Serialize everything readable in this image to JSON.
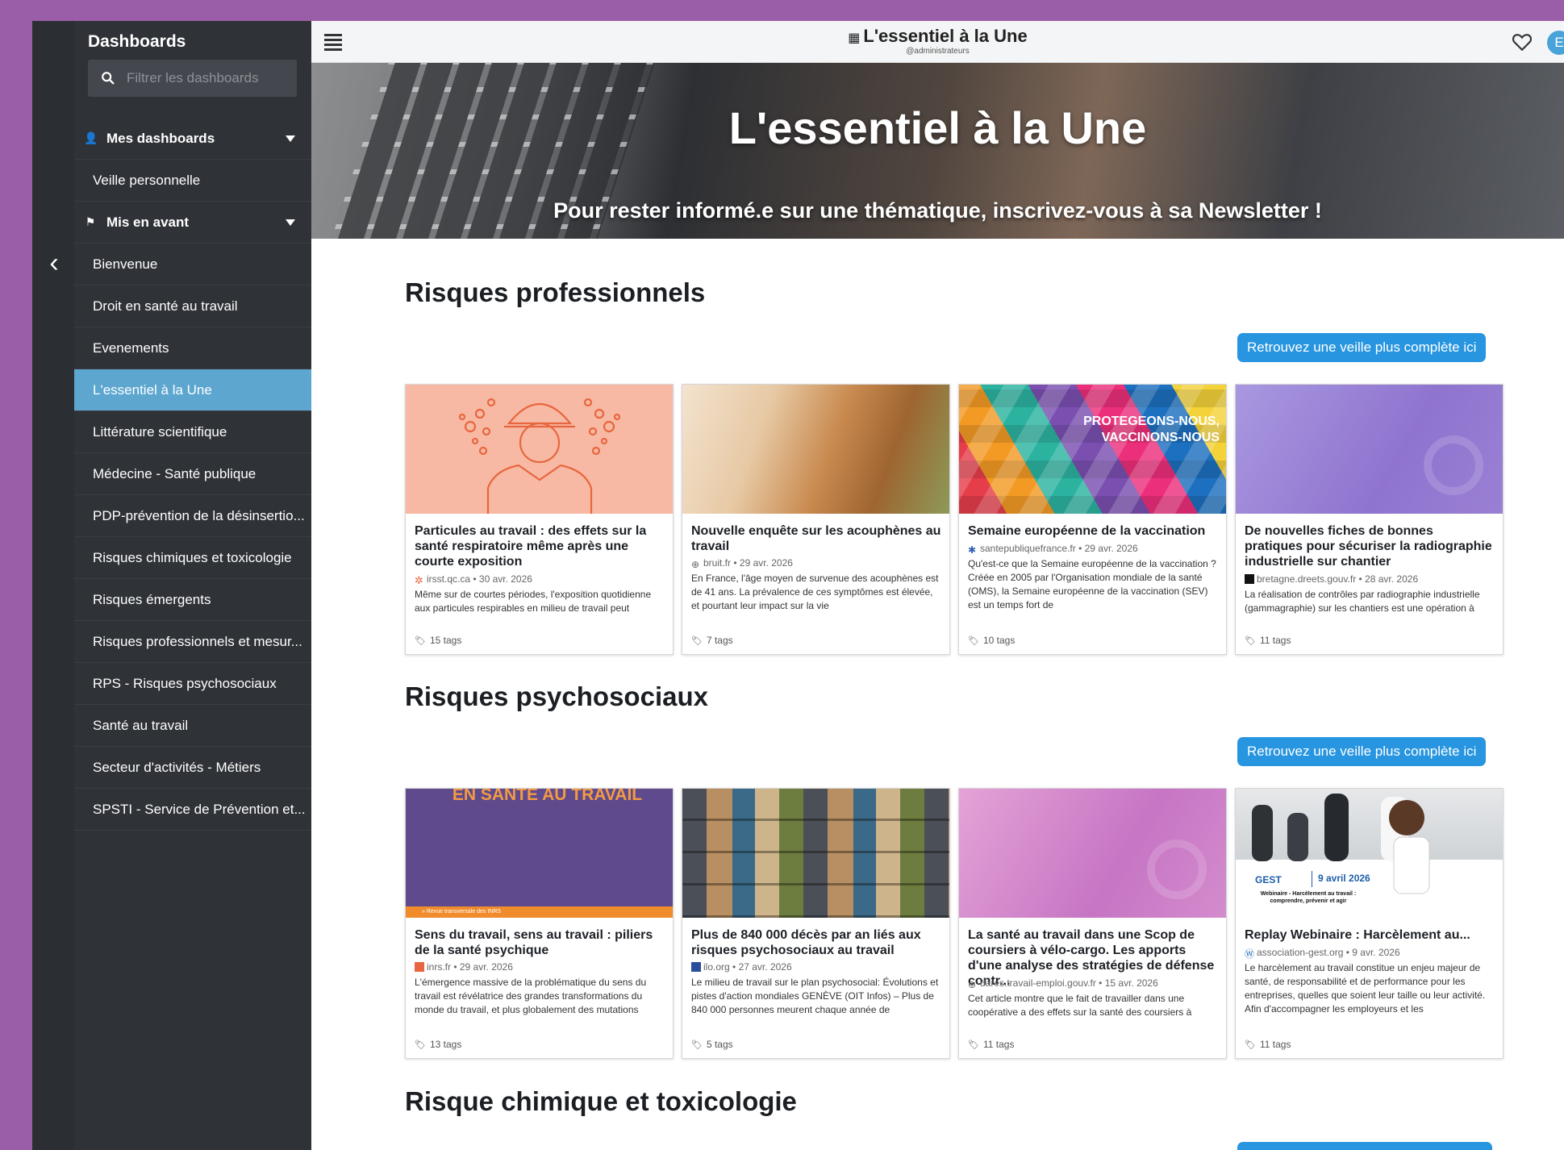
{
  "sidebar": {
    "title": "Dashboards",
    "search_placeholder": "Filtrer les dashboards",
    "sections": [
      {
        "label": "Mes dashboards",
        "icon": "user-icon",
        "items": [
          "Veille personnelle"
        ]
      },
      {
        "label": "Mis en avant",
        "icon": "flag-icon",
        "items": [
          "Bienvenue",
          "Droit en santé au travail",
          "Evenements",
          "L'essentiel à la Une",
          "Littérature scientifique",
          "Médecine - Santé publique",
          "PDP-prévention de la désinsertio...",
          "Risques chimiques et toxicologie",
          "Risques émergents",
          "Risques professionnels et mesur...",
          "RPS - Risques psychosociaux",
          "Santé au travail",
          "Secteur d'activités - Métiers",
          "SPSTI - Service de Prévention et..."
        ]
      }
    ],
    "active_item": "L'essentiel à la Une"
  },
  "topbar": {
    "title": "L'essentiel à la Une",
    "subtitle": "@administrateurs",
    "avatar_initial": "E"
  },
  "hero": {
    "title": "L'essentiel à la Une",
    "subtitle": "Pour rester informé.e sur une thématique, inscrivez-vous à sa Newsletter !"
  },
  "sections": [
    {
      "title": "Risques professionnels",
      "more_label": "Retrouvez une veille plus complète ici",
      "cards": [
        {
          "title": "Particules au travail : des effets sur la santé respiratoire même après une courte exposition",
          "source": "irsst.qc.ca",
          "date": "30 avr. 2026",
          "desc": "Même sur de courtes périodes, l'exposition quotidienne aux particules respirables en milieu de travail peut",
          "tags": "15 tags"
        },
        {
          "title": "Nouvelle enquête sur les acouphènes au travail",
          "source": "bruit.fr",
          "date": "29 avr. 2026",
          "desc": "En France, l'âge moyen de survenue des acouphènes est de 41 ans. La prévalence de ces symptômes est élevée, et pourtant leur impact sur la vie",
          "tags": "7 tags"
        },
        {
          "title": "Semaine européenne de la vaccination",
          "source": "santepubliquefrance.fr",
          "date": "29 avr. 2026",
          "desc": "Qu'est-ce que la Semaine européenne de la vaccination ? Créée en 2005 par l'Organisation mondiale de la santé (OMS), la Semaine européenne de la vaccination (SEV) est un temps fort de",
          "image_text": "PROTEGEONS-NOUS, VACCINONS-NOUS",
          "tags": "10 tags"
        },
        {
          "title": "De nouvelles fiches de bonnes pratiques pour sécuriser la radiographie industrielle sur chantier",
          "source": "bretagne.dreets.gouv.fr",
          "date": "28 avr. 2026",
          "desc": "La réalisation de contrôles par radiographie industrielle (gammagraphie) sur les chantiers est une opération à",
          "tags": "11 tags"
        }
      ]
    },
    {
      "title": "Risques psychosociaux",
      "more_label": "Retrouvez une veille plus complète ici",
      "cards": [
        {
          "title": "Sens du travail, sens au travail : piliers de la santé psychique",
          "source": "inrs.fr",
          "date": "29 avr. 2026",
          "desc": "L'émergence massive de la problématique du sens du travail est révélatrice des grandes transformations du monde du travail, et plus globalement des mutations",
          "image_text": "EN SANTÉ AU TRAVAIL",
          "stripe_text": "» Revue transversale des INRS",
          "tags": "13 tags"
        },
        {
          "title": "Plus de 840 000 décès par an liés aux risques psychosociaux au travail",
          "source": "ilo.org",
          "date": "27 avr. 2026",
          "desc": "Le milieu de travail sur le plan psychosocial: Évolutions et pistes d'action mondiales GENÈVE (OIT Infos) – Plus de 840 000 personnes meurent chaque année de",
          "tags": "5 tags"
        },
        {
          "title": "La santé au travail dans une Scop de coursiers à vélo-cargo. Les apports d'une analyse des stratégies de défense contr...",
          "source": "dares.travail-emploi.gouv.fr",
          "date": "15 avr. 2026",
          "desc": "Cet article montre que le fait de travailler dans une coopérative a des effets sur la santé des coursiers à",
          "tags": "11 tags"
        },
        {
          "title": "Replay Webinaire : Harcèlement au...",
          "source": "association-gest.org",
          "date": "9 avr. 2026",
          "desc": "Le harcèlement au travail constitue un enjeu majeur de santé, de responsabilité et de performance pour les entreprises, quelles que soient leur taille ou leur activité. Afin d'accompagner les employeurs et les",
          "image_text": "9 avril 2026",
          "image_sub": "Webinaire - Harcèlement au travail : comprendre, prévenir et agir",
          "image_logo": "GEST",
          "tags": "11 tags"
        }
      ]
    },
    {
      "title": "Risque chimique et toxicologie"
    }
  ]
}
